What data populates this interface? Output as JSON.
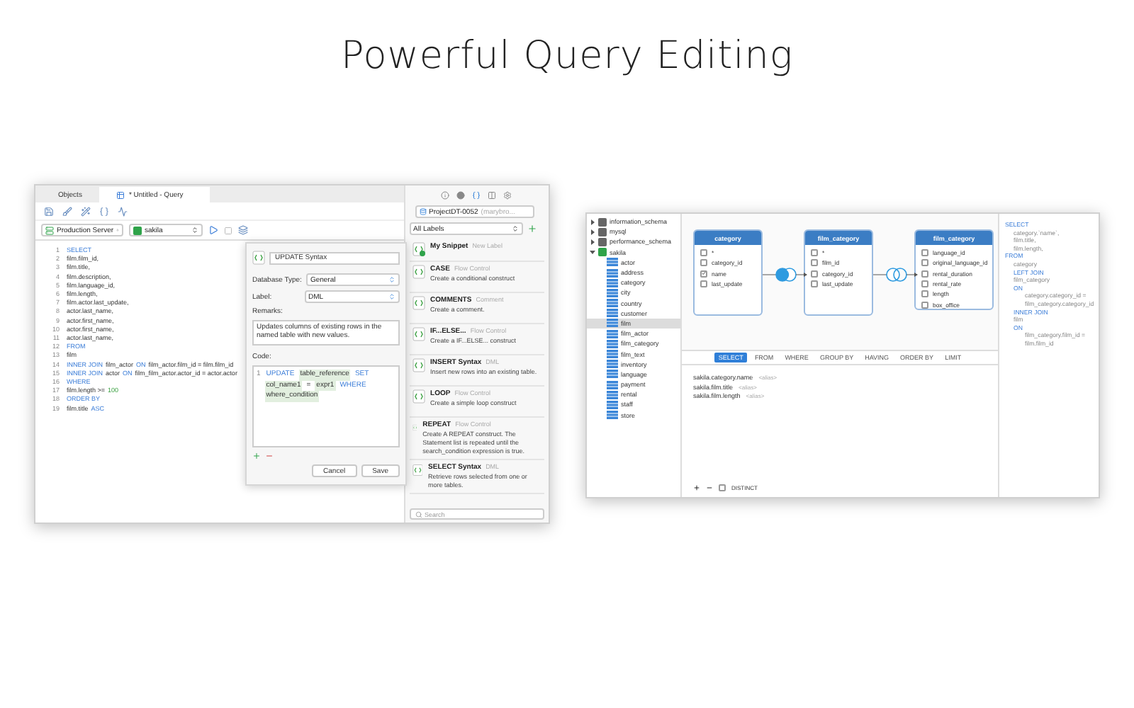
{
  "headline": "Powerful Query Editing",
  "query_window": {
    "tabs": [
      {
        "label": "Objects",
        "selected": false
      },
      {
        "label": "* Untitled - Query",
        "selected": true
      }
    ],
    "connection": "Production Server",
    "database": "sakila",
    "editor_lines": [
      {
        "number": "1",
        "tokens": [
          {
            "text": "SELECT",
            "kind": "keyword"
          }
        ]
      },
      {
        "number": "2",
        "tokens": [
          {
            "text": "film.film_id,",
            "kind": "plain"
          }
        ]
      },
      {
        "number": "3",
        "tokens": [
          {
            "text": "film.title,",
            "kind": "plain"
          }
        ]
      },
      {
        "number": "4",
        "tokens": [
          {
            "text": "film.description,",
            "kind": "plain"
          }
        ]
      },
      {
        "number": "5",
        "tokens": [
          {
            "text": "film.language_id,",
            "kind": "plain"
          }
        ]
      },
      {
        "number": "6",
        "tokens": [
          {
            "text": "film.length,",
            "kind": "plain"
          }
        ]
      },
      {
        "number": "7",
        "tokens": [
          {
            "text": "film.actor.last_update,",
            "kind": "plain"
          }
        ]
      },
      {
        "number": "8",
        "tokens": [
          {
            "text": "actor.last_name,",
            "kind": "plain"
          }
        ]
      },
      {
        "number": "9",
        "tokens": [
          {
            "text": "actor.first_name,",
            "kind": "plain"
          }
        ]
      },
      {
        "number": "10",
        "tokens": [
          {
            "text": "actor.first_name,",
            "kind": "plain"
          }
        ]
      },
      {
        "number": "11",
        "tokens": [
          {
            "text": "actor.last_name,",
            "kind": "plain"
          }
        ]
      },
      {
        "number": "12",
        "tokens": [
          {
            "text": "FROM",
            "kind": "keyword"
          }
        ]
      },
      {
        "number": "13",
        "tokens": [
          {
            "text": "film",
            "kind": "plain"
          }
        ]
      },
      {
        "number": "14",
        "tokens": [
          {
            "text": "INNER JOIN",
            "kind": "keyword"
          },
          {
            "text": "film_actor",
            "kind": "plain"
          },
          {
            "text": "ON",
            "kind": "keyword"
          },
          {
            "text": "film_actor.film_id = film.film_id",
            "kind": "plain"
          }
        ]
      },
      {
        "number": "15",
        "tokens": [
          {
            "text": "INNER JOIN",
            "kind": "keyword"
          },
          {
            "text": "actor",
            "kind": "plain"
          },
          {
            "text": "ON",
            "kind": "keyword"
          },
          {
            "text": "film_film_actor.actor_id = actor.actor",
            "kind": "plain"
          }
        ]
      },
      {
        "number": "16",
        "tokens": [
          {
            "text": "WHERE",
            "kind": "keyword"
          }
        ]
      },
      {
        "number": "17",
        "tokens": [
          {
            "text": "film.length >=",
            "kind": "plain"
          },
          {
            "text": "100",
            "kind": "number"
          }
        ]
      },
      {
        "number": "18",
        "tokens": [
          {
            "text": "ORDER BY",
            "kind": "keyword"
          }
        ]
      },
      {
        "number": "19",
        "tokens": [
          {
            "text": "film.title",
            "kind": "plain"
          },
          {
            "text": "ASC",
            "kind": "keyword"
          }
        ]
      }
    ],
    "snippet_dialog": {
      "name": "UPDATE Syntax",
      "database_type_label": "Database Type:",
      "database_type": "General",
      "label_label": "Label:",
      "label": "DML",
      "remarks_label": "Remarks:",
      "remarks": "Updates columns of existing rows in the named table with new values.",
      "code_label": "Code:",
      "code_number": "1",
      "code_tokens": [
        {
          "text": "UPDATE",
          "kind": "keyword"
        },
        {
          "text": "table_reference",
          "kind": "placeholder"
        },
        {
          "text": "SET",
          "kind": "keyword"
        },
        {
          "text": "col_name1",
          "kind": "placeholder"
        },
        {
          "text": "=",
          "kind": "plain"
        },
        {
          "text": "expr1",
          "kind": "placeholder"
        },
        {
          "text": "WHERE",
          "kind": "keyword"
        },
        {
          "text": "where_condition",
          "kind": "placeholder"
        }
      ],
      "buttons": [
        "Cancel",
        "Save"
      ]
    },
    "snippet_panel": {
      "project": "ProjectDT-0052",
      "project_owner": "(marybro...",
      "labels_filter": "All Labels",
      "snippets": [
        {
          "kind": "new",
          "name": "My Snippet",
          "label": "New Label"
        },
        {
          "kind": "snippet",
          "name": "CASE",
          "label": "Flow Control",
          "description": "Create a conditional construct"
        },
        {
          "kind": "snippet",
          "name": "COMMENTS",
          "label": "Comment",
          "description": "Create a comment."
        },
        {
          "kind": "snippet",
          "name": "IF...ELSE...",
          "label": "Flow Control",
          "description": "Create a IF...ELSE... construct"
        },
        {
          "kind": "snippet",
          "name": "INSERT Syntax",
          "label": "DML",
          "description": "Insert new rows into an existing table."
        },
        {
          "kind": "snippet",
          "name": "LOOP",
          "label": "Flow Control",
          "description": "Create a simple loop construct"
        },
        {
          "kind": "snippet",
          "name": "REPEAT",
          "label": "Flow Control",
          "description": "Create A REPEAT construct. The Statement list is repeated until the search_condition expression is true."
        },
        {
          "kind": "snippet",
          "name": "SELECT Syntax",
          "label": "DML",
          "description": "Retrieve rows selected from one or more tables."
        }
      ],
      "search_placeholder": "Search"
    }
  },
  "query_builder": {
    "tree": [
      {
        "name": "information_schema",
        "expanded": false,
        "selected": false
      },
      {
        "name": "mysql",
        "expanded": false,
        "selected": false
      },
      {
        "name": "performance_schema",
        "expanded": false,
        "selected": false
      },
      {
        "name": "sakila",
        "expanded": true,
        "selected": false,
        "children": [
          {
            "name": "actor",
            "selected": false
          },
          {
            "name": "address",
            "selected": false
          },
          {
            "name": "category",
            "selected": false
          },
          {
            "name": "city",
            "selected": false
          },
          {
            "name": "country",
            "selected": false
          },
          {
            "name": "customer",
            "selected": false
          },
          {
            "name": "film",
            "selected": true
          },
          {
            "name": "film_actor",
            "selected": false
          },
          {
            "name": "film_category",
            "selected": false
          },
          {
            "name": "film_text",
            "selected": false
          },
          {
            "name": "inventory",
            "selected": false
          },
          {
            "name": "language",
            "selected": false
          },
          {
            "name": "payment",
            "selected": false
          },
          {
            "name": "rental",
            "selected": false
          },
          {
            "name": "staff",
            "selected": false
          },
          {
            "name": "store",
            "selected": false
          }
        ]
      }
    ],
    "tables": [
      {
        "name": "category",
        "columns": [
          {
            "name": "*",
            "checked": false
          },
          {
            "name": "category_id",
            "checked": false
          },
          {
            "name": "name",
            "checked": true
          },
          {
            "name": "last_update",
            "checked": false
          }
        ]
      },
      {
        "name": "film_category",
        "columns": [
          {
            "name": "*",
            "checked": false
          },
          {
            "name": "film_id",
            "checked": false
          },
          {
            "name": "category_id",
            "checked": false
          },
          {
            "name": "last_update",
            "checked": false
          }
        ]
      },
      {
        "name": "film_category",
        "columns": [
          {
            "name": "language_id",
            "checked": false
          },
          {
            "name": "original_language_id",
            "checked": false
          },
          {
            "name": "rental_duration",
            "checked": false
          },
          {
            "name": "rental_rate",
            "checked": false
          },
          {
            "name": "length",
            "checked": false
          },
          {
            "name": "box_office",
            "checked": false
          }
        ]
      }
    ],
    "joins": [
      {
        "kind": "left"
      },
      {
        "kind": "inner"
      }
    ],
    "clause_tabs": [
      {
        "label": "SELECT",
        "selected": true
      },
      {
        "label": "FROM",
        "selected": false
      },
      {
        "label": "WHERE",
        "selected": false
      },
      {
        "label": "GROUP BY",
        "selected": false
      },
      {
        "label": "HAVING",
        "selected": false
      },
      {
        "label": "ORDER BY",
        "selected": false
      },
      {
        "label": "LIMIT",
        "selected": false
      }
    ],
    "select_fields": [
      {
        "field": "sakila.category.name",
        "alias": "<alias>"
      },
      {
        "field": "sakila.film.title",
        "alias": "<alias>"
      },
      {
        "field": "sakila.film.length",
        "alias": "<alias>"
      }
    ],
    "distinct_label": "DISTINCT",
    "distinct": false,
    "sql_preview": [
      {
        "text": "SELECT",
        "kind": "clause"
      },
      {
        "text": "category.`name`,",
        "kind": "item"
      },
      {
        "text": "film.title,",
        "kind": "item"
      },
      {
        "text": "film.length,",
        "kind": "item"
      },
      {
        "text": "FROM",
        "kind": "clause"
      },
      {
        "text": "category",
        "kind": "item"
      },
      {
        "text": "LEFT JOIN",
        "kind": "keyword"
      },
      {
        "text": "film_category",
        "kind": "item"
      },
      {
        "text": "ON",
        "kind": "keyword"
      },
      {
        "text": "category.category_id = film_category.category_id",
        "kind": "condition"
      },
      {
        "text": "INNER JOIN",
        "kind": "keyword"
      },
      {
        "text": "film",
        "kind": "item"
      },
      {
        "text": "ON",
        "kind": "keyword"
      },
      {
        "text": "film_category.film_id = film.film_id",
        "kind": "condition"
      }
    ]
  }
}
